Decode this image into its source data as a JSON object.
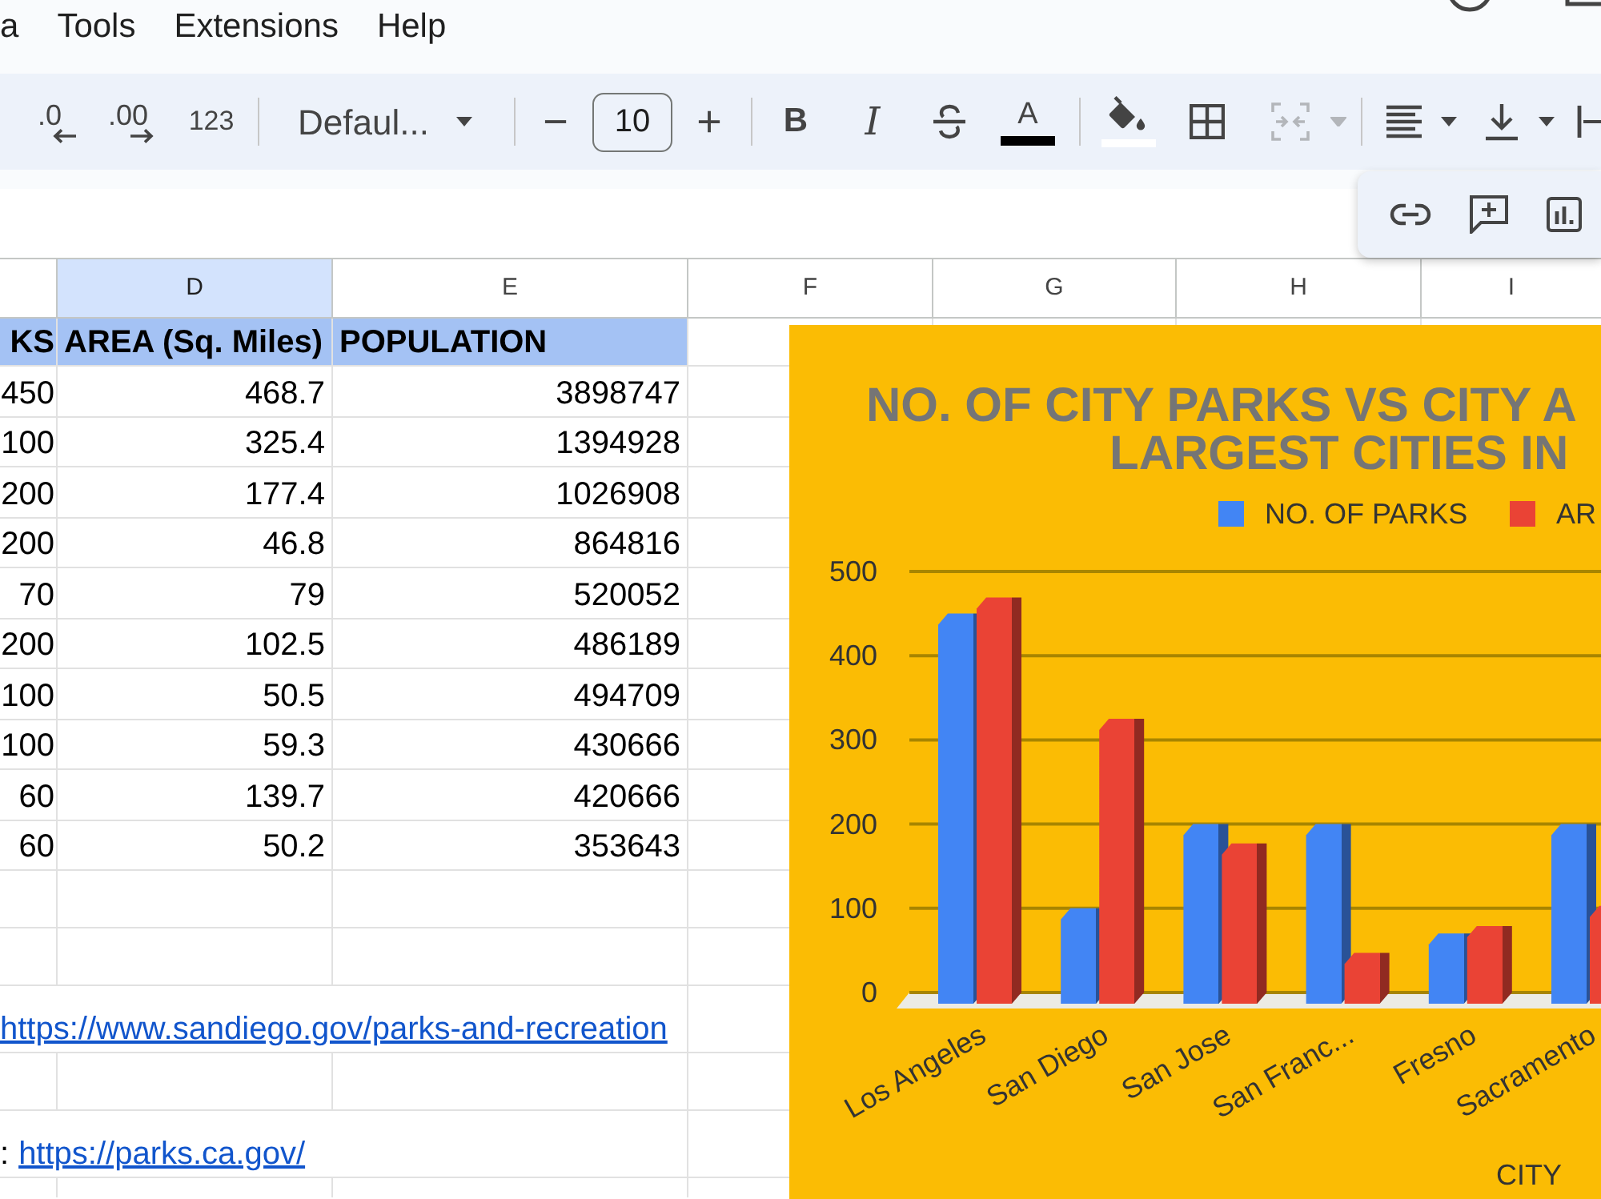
{
  "menu_bar": {
    "items": [
      "a",
      "Tools",
      "Extensions",
      "Help"
    ]
  },
  "toolbar": {
    "decrease_decimal": ".0",
    "increase_decimal": ".00",
    "number_format": "123",
    "font": "Defaul...",
    "decrease_font_size": "−",
    "font_size": {
      "value": "10"
    },
    "increase_font_size": "+",
    "bold": "B",
    "italic": "I",
    "text_color": "A",
    "merge": {
      "disabled": true
    }
  },
  "sheet": {
    "columns": [
      {
        "label": "D",
        "selected": true
      },
      {
        "label": "E",
        "selected": false
      },
      {
        "label": "F",
        "selected": false
      },
      {
        "label": "G",
        "selected": false
      },
      {
        "label": "H",
        "selected": false
      },
      {
        "label": "I",
        "selected": false
      }
    ],
    "table": {
      "header": [
        "KS",
        "AREA (Sq. Miles)",
        "POPULATION"
      ],
      "rows": [
        [
          "450",
          "468.7",
          "3898747"
        ],
        [
          "100",
          "325.4",
          "1394928"
        ],
        [
          "200",
          "177.4",
          "1026908"
        ],
        [
          "200",
          "46.8",
          "864816"
        ],
        [
          "70",
          "79",
          "520052"
        ],
        [
          "200",
          "102.5",
          "486189"
        ],
        [
          "100",
          "50.5",
          "494709"
        ],
        [
          "100",
          "59.3",
          "430666"
        ],
        [
          "60",
          "139.7",
          "420666"
        ],
        [
          "60",
          "50.2",
          "353643"
        ]
      ]
    },
    "lower_rows": [
      {
        "kind": "blank"
      },
      {
        "kind": "blank"
      },
      {
        "kind": "link",
        "link": "https://www.sandiego.gov/parks-and-recreation"
      },
      {
        "kind": "blank"
      },
      {
        "kind": "link",
        "text": ":",
        "link": "https://parks.ca.gov/"
      },
      {
        "kind": "blank"
      }
    ]
  },
  "chart": {
    "title_lines": [
      "NO. OF CITY PARKS VS CITY A",
      "LARGEST CITIES IN"
    ],
    "chart_data": {
      "type": "bar",
      "xlabel": "CITY",
      "categories": [
        "Los Angeles",
        "San Diego",
        "San Jose",
        "San Franc...",
        "Fresno",
        "Sacramento"
      ],
      "series": [
        {
          "name": "NO. OF PARKS",
          "color": "#4285f4",
          "values": [
            450,
            100,
            200,
            200,
            70,
            200
          ]
        },
        {
          "name": "AR",
          "color": "#ea4335",
          "values": [
            469,
            325,
            177,
            47,
            79,
            103
          ]
        }
      ],
      "ylim": [
        0,
        500
      ],
      "yticks": [
        {
          "value": 0,
          "label": "0"
        },
        {
          "value": 100,
          "label": "100"
        },
        {
          "value": 200,
          "label": "200"
        },
        {
          "value": 300,
          "label": "300"
        },
        {
          "value": 400,
          "label": "400"
        },
        {
          "value": 500,
          "label": "500"
        }
      ],
      "grid": true,
      "legend": "top"
    }
  }
}
